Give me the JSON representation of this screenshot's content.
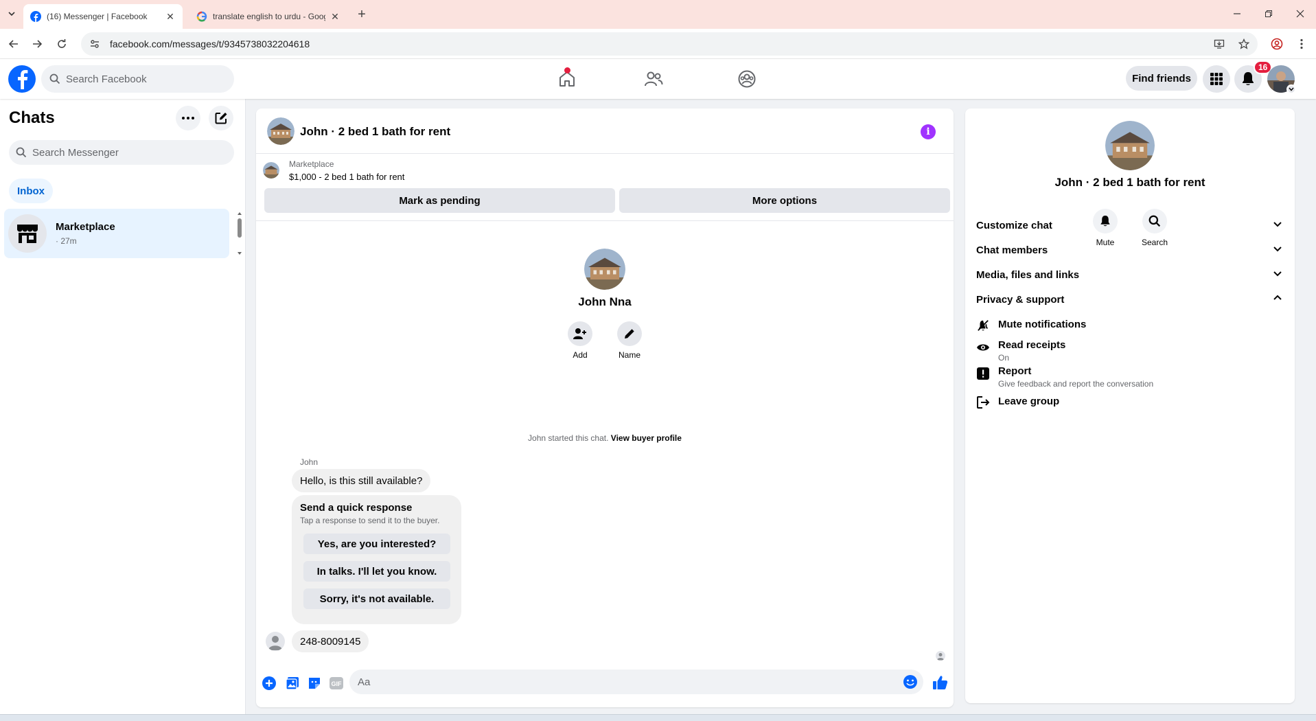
{
  "browser": {
    "tabs": [
      {
        "title": "(16) Messenger | Facebook",
        "active": true
      },
      {
        "title": "translate english to urdu - Goog",
        "active": false
      }
    ],
    "new_tab_label": "+",
    "url": "facebook.com/messages/t/9345738032204618"
  },
  "fb_header": {
    "search_placeholder": "Search Facebook",
    "find_friends_label": "Find friends",
    "notification_count": "16",
    "brand_color": "#0866ff",
    "nav_icons": [
      "home-icon",
      "friends-icon",
      "groups-icon"
    ]
  },
  "sidebar": {
    "title": "Chats",
    "search_placeholder": "Search Messenger",
    "filter_label": "Inbox",
    "chats": [
      {
        "name": "Marketplace",
        "meta": "· 27m",
        "icon": "marketplace-store-icon"
      }
    ]
  },
  "conversation": {
    "title": "John · 2 bed 1 bath for rent",
    "marketplace": {
      "label": "Marketplace",
      "listing": "$1,000 - 2 bed 1 bath for rent",
      "pending_button": "Mark as pending",
      "more_options_button": "More options"
    },
    "profile": {
      "name": "John Nna",
      "actions": [
        {
          "label": "Add",
          "icon": "add-person-icon"
        },
        {
          "label": "Name",
          "icon": "pencil-icon"
        }
      ]
    },
    "started_text": "John started this chat.",
    "view_buyer_profile": "View buyer profile",
    "messages": [
      {
        "sender": "John",
        "text": "Hello, is this still available?"
      }
    ],
    "quick_response": {
      "title": "Send a quick response",
      "subtitle": "Tap a response to send it to the buyer.",
      "options": [
        "Yes, are you interested?",
        "In talks. I'll let you know.",
        "Sorry, it's not available."
      ]
    },
    "outgoing_message": "248-8009145",
    "composer_placeholder": "Aa"
  },
  "info_panel": {
    "name": "John · 2 bed 1 bath for rent",
    "actions": [
      {
        "label": "Mute",
        "icon": "bell-icon"
      },
      {
        "label": "Search",
        "icon": "search-icon"
      }
    ],
    "sections": [
      {
        "label": "Customize chat",
        "expanded": false
      },
      {
        "label": "Chat members",
        "expanded": false
      },
      {
        "label": "Media, files and links",
        "expanded": false
      },
      {
        "label": "Privacy & support",
        "expanded": true
      }
    ],
    "privacy_items": [
      {
        "label": "Mute notifications",
        "sub": "",
        "icon": "bell-slash-icon"
      },
      {
        "label": "Read receipts",
        "sub": "On",
        "icon": "eye-icon"
      },
      {
        "label": "Report",
        "sub": "Give feedback and report the conversation",
        "icon": "report-icon"
      },
      {
        "label": "Leave group",
        "sub": "",
        "icon": "leave-icon"
      }
    ]
  },
  "colors": {
    "accent": "#0866ff",
    "info_purple": "#a033ff",
    "badge_red": "#e41e3f",
    "selected_chat_bg": "#e7f3ff"
  }
}
